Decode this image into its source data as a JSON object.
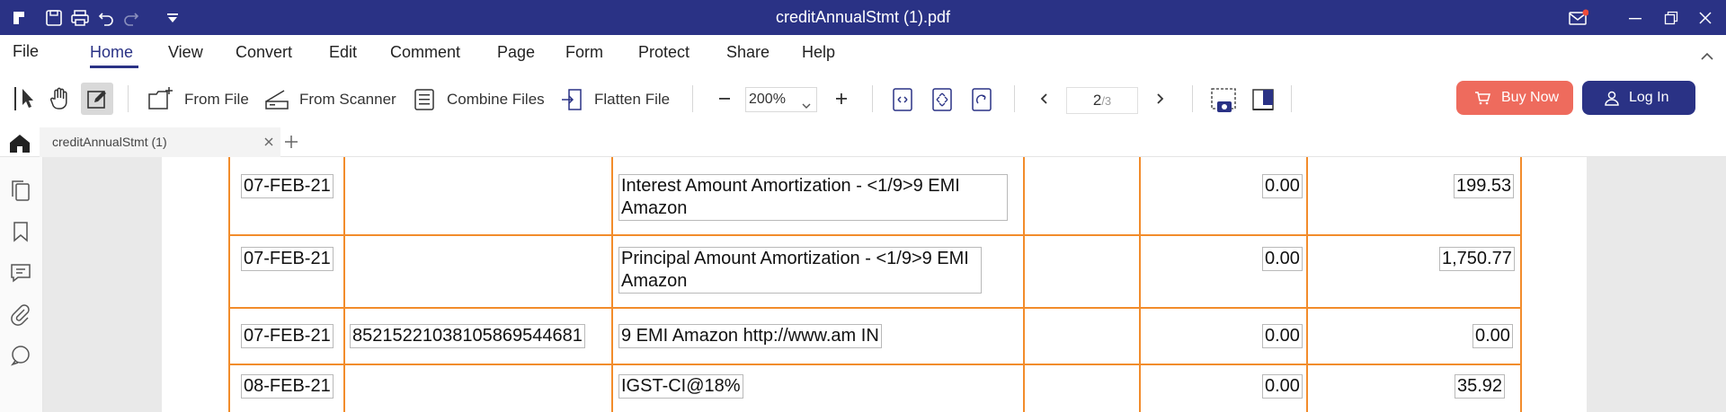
{
  "titlebar": {
    "title": "creditAnnualStmt (1).pdf",
    "icons": [
      "app-logo-icon",
      "save-icon",
      "print-icon",
      "undo-icon",
      "redo-icon",
      "quick-access-dropdown-icon",
      "mail-icon",
      "minimize-icon",
      "restore-icon",
      "close-icon"
    ],
    "accent_color": "#2a3285"
  },
  "menubar": {
    "file": "File",
    "items": [
      "Home",
      "View",
      "Convert",
      "Edit",
      "Comment",
      "Page",
      "Form",
      "Protect",
      "Share",
      "Help"
    ],
    "active": "Home"
  },
  "toolbar": {
    "from_file": "From File",
    "from_scanner": "From Scanner",
    "combine_files": "Combine Files",
    "flatten_file": "Flatten File",
    "zoom": "200%",
    "page_current": "2",
    "page_total": "/3",
    "buy_now": "Buy Now",
    "log_in": "Log In",
    "buy_color": "#ee6b5d"
  },
  "tabs": {
    "doc_tab": "creditAnnualStmt (1)"
  },
  "statement": {
    "grid_color": "#f28c2b",
    "rows": [
      {
        "date": "07-FEB-21",
        "ref": "",
        "desc": "Interest Amount Amortization - <1/9>9 EMI Amazon",
        "amount1": "0.00",
        "amount2": "199.53"
      },
      {
        "date": "07-FEB-21",
        "ref": "",
        "desc": "Principal Amount Amortization - <1/9>9 EMI Amazon",
        "amount1": "0.00",
        "amount2": "1,750.77"
      },
      {
        "date": "07-FEB-21",
        "ref": "85215221038105869544681",
        "desc": "9 EMI Amazon http://www.am IN",
        "amount1": "0.00",
        "amount2": "0.00"
      },
      {
        "date": "08-FEB-21",
        "ref": "",
        "desc": "IGST-CI@18%",
        "amount1": "0.00",
        "amount2": "35.92"
      }
    ]
  }
}
